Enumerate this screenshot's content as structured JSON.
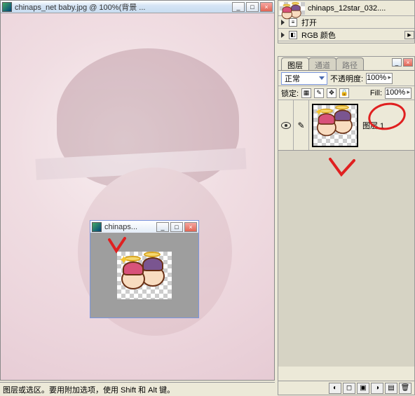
{
  "main_window": {
    "title": "chinaps_net baby.jpg @ 100%(背景 ..."
  },
  "sub_window": {
    "title": "chinaps..."
  },
  "top_panel": {
    "filename": "chinaps_12star_032....",
    "open_label": "打开",
    "mode_label": "RGB 颜色"
  },
  "layers_panel": {
    "tabs": [
      "图层",
      "通道",
      "路径"
    ],
    "blend_mode": "正常",
    "opacity_label": "不透明度:",
    "opacity_value": "100%",
    "lock_label": "锁定:",
    "fill_label": "Fill:",
    "fill_value": "100%",
    "layers": [
      {
        "name": "图层 1"
      }
    ]
  },
  "statusbar": {
    "text": "图层或选区。要用附加选项，使用 Shift 和 Alt 键。"
  }
}
